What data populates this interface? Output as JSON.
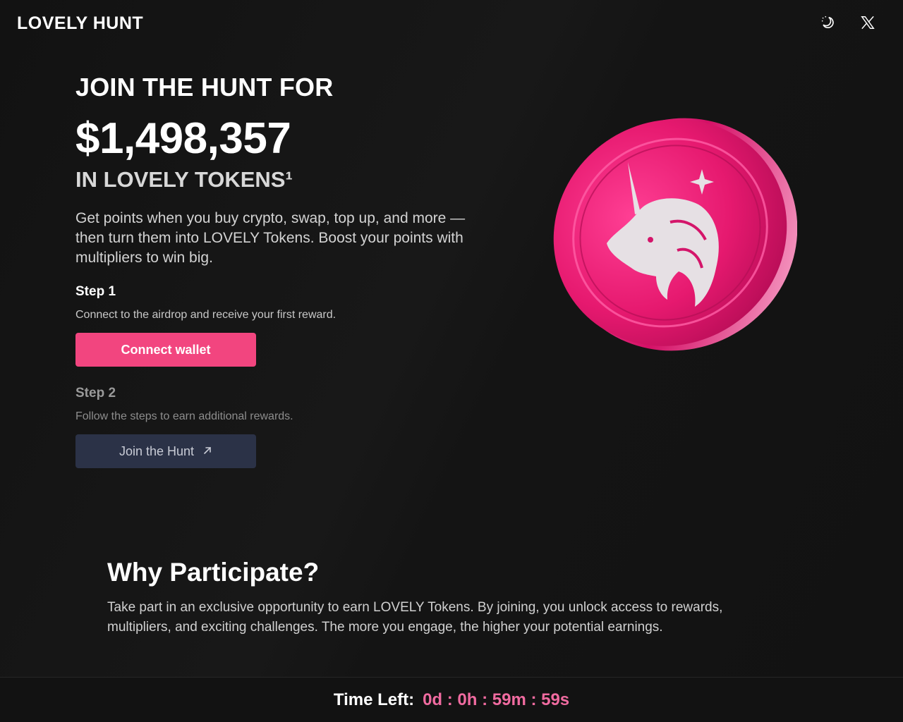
{
  "header": {
    "logo": "LOVELY HUNT",
    "icons": [
      "theme-toggle-icon",
      "x-logo-icon"
    ]
  },
  "hero": {
    "kicker": "JOIN THE HUNT FOR",
    "amount": "$1,498,357",
    "subhead": "IN LOVELY TOKENS¹",
    "intro": "Get points when you buy crypto, swap, top up, and more — then turn them into LOVELY Tokens. Boost your points with multipliers to win big."
  },
  "steps": [
    {
      "title": "Step 1",
      "description": "Connect to the airdrop and receive your first reward.",
      "button": "Connect wallet"
    },
    {
      "title": "Step 2",
      "description": "Follow the steps to earn additional rewards.",
      "button": "Join the Hunt"
    }
  ],
  "why": {
    "title": "Why Participate?",
    "text": "Take part in an exclusive opportunity to earn LOVELY Tokens. By joining, you unlock access to rewards, multipliers, and exciting challenges. The more you engage, the higher your potential earnings."
  },
  "footer": {
    "timer_label": "Time Left:",
    "timer_value": "0d : 0h : 59m : 59s"
  },
  "colors": {
    "accent": "#f2457f",
    "secondary_button": "#2b3247",
    "timer": "#f06ba0",
    "background": "#131313"
  }
}
